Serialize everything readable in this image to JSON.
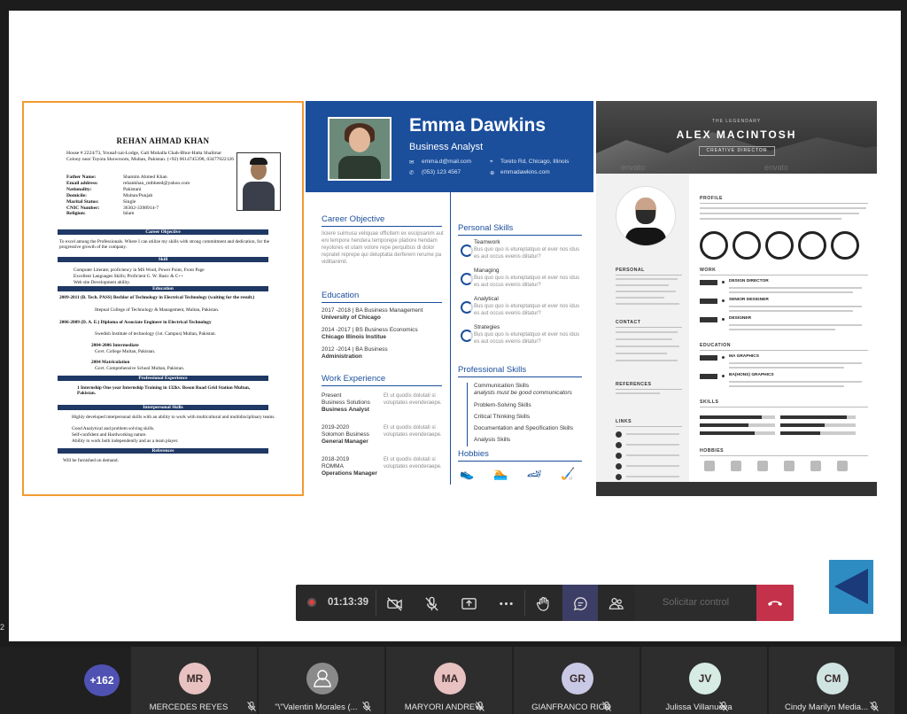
{
  "slide": {
    "edge_number": "2",
    "resume1": {
      "name": "REHAN AHMAD KHAN",
      "address": "House # 2224/73, Yousaf-zai-Lodge, Gali Muhalla Chah-Bhur-Hatta Shalimar Colony near Toyota Showroom, Multan, Pakistan. (+92) 0614745398, 03477022126",
      "fields": [
        {
          "k": "Father Name:",
          "v": "Shamim Ahmed Khan"
        },
        {
          "k": "Email address:",
          "v": "rehankhan_mtbheed@yahoo.com"
        },
        {
          "k": "Nationality:",
          "v": "Pakistani"
        },
        {
          "k": "Domicile:",
          "v": "Multan/Punjab"
        },
        {
          "k": "Marital Status:",
          "v": "Single"
        },
        {
          "k": "CNIC Number:",
          "v": "36302-3398914-7"
        },
        {
          "k": "Religion:",
          "v": "Islam"
        }
      ],
      "career_objective": "Career Objective",
      "objective_text": "To excel among the Professionals. Where I can utilize my skills with strong commitment and dedication, for the progressive growth of the company.",
      "skill": "Skill",
      "skills": [
        "Computer Literate; proficiency in MS Word, Power Point, Front Page",
        "Excellent Languages Skills; Proficient G. W. Basic & C++",
        "Web site Development ability."
      ],
      "education": "Education",
      "edu1": "2009-2011 (B. Tech. PASS) Bechlor of Technology in Electrical Technology (waiting for the result.)",
      "edu1b": "Ittepnal College of Technology & Management, Multan, Pakistan.",
      "edu2": "2006-2009 (D. A. E.) Diploma of Associate Engineer in Electrical Technology",
      "edu2b": "Swedish Institute of technology (1st. Campus) Multan, Pakistan.",
      "edu3": "2004-2006 Intermediate",
      "edu3b": "Govt. College Multan, Pakistan.",
      "edu4": "2004 Matriculation",
      "edu4b": "Govt. Comprehensive School Multan, Pakistan.",
      "professional_experience": "Professional Experience",
      "internship": "1 Internship One year Internship Training in 132kv. Boson Road Grid Station Multan, Pakistan.",
      "interpersonal_skills": "Interpersonal Skills",
      "interpersonal": [
        "Highly developed interpersonal skills with an ability to work with multicultural and multidisciplinary teams.",
        "Good Analytical and problem solving skills.",
        "Self-confident and Hardworking nature.",
        "Ability to work both independently and as a team player."
      ],
      "references": "References",
      "references_text": "Will be furnished on demand."
    },
    "resume2": {
      "name": "Emma Dawkins",
      "title": "Business Analyst",
      "email": "emma.d@mail.com",
      "address": "Toreto Rd, Chicago, Illinois",
      "phone": "(053) 123 4567",
      "website": "emmadawkins.com",
      "career_objective": "Career Objective",
      "objective_text": "Iiciere suimusa veliquae officitem ex escipsanim aut eni tempore hendera temporepe plabore hendam reyolores et utam volore repe perquibus di dolor repratet reprepe qui deluptatia derferem rerume pa viditianimil.",
      "education": "Education",
      "edu": [
        {
          "line": "2017 -2018 | BA Business Management",
          "school": "University of Chicago"
        },
        {
          "line": "2014 -2017 | BS Business Economics",
          "school": "Chicago Illinois Institue"
        },
        {
          "line": "2012 -2014 | BA Business",
          "school": "Administration"
        }
      ],
      "work_experience": "Work Experience",
      "work": [
        {
          "a": "Present",
          "b": "Business Solutions",
          "c": "Business Analyst"
        },
        {
          "a": "2019-2020",
          "b": "Solomon Business",
          "c": "General Manager"
        },
        {
          "a": "2018-2019",
          "b": "ROMMA",
          "c": "Operations Manager"
        }
      ],
      "work_desc": "Et ut quodis dolutati si voluptates evenderaepe.",
      "personal_skills": "Personal Skills",
      "pskills": [
        "Teamwork",
        "Managing",
        "Analytical",
        "Strategies"
      ],
      "pskill_desc": "Bus quo quo is etureptatquo et ever nos idus es aut occus evenis diitatur?",
      "professional_skills": "Professional Skills",
      "prof_skills": [
        "Communication Skills",
        "Problem-Solving Skills",
        "Critical Thinking Skills",
        "Documentation and Specification Skills",
        "Analysis Skills"
      ],
      "prof_note": "analysts must be good communicators",
      "hobbies": "Hobbies"
    },
    "resume3": {
      "legendary": "THE LEGENDARY",
      "name": "ALEX MACINTOSH",
      "title": "CREATIVE DIRECTOR",
      "watermark": "envato",
      "sections": {
        "profile": "PROFILE",
        "work": "WORK",
        "education": "EDUCATION",
        "skills": "SKILLS",
        "hobbies": "HOBBIES",
        "personal": "PERSONAL",
        "contact": "CONTACT",
        "references": "REFERENCES",
        "links": "LINKS"
      },
      "jobs": [
        "DESIGN DIRECTOR",
        "SENIOR DESIGNER",
        "DESIGNER"
      ],
      "schools": [
        "MA GRAPHICS",
        "BA(HONS) GRAPHICS"
      ]
    }
  },
  "toolbar": {
    "timer": "01:13:39",
    "request_control": "Solicitar control"
  },
  "participants": {
    "more_count": "+162",
    "list": [
      {
        "initials": "MR",
        "name": "MERCEDES REYES",
        "color": "#e8c1c1"
      },
      {
        "initials": "",
        "name": "\"\\\"Valentin Morales (...",
        "color": "#8a8a8a"
      },
      {
        "initials": "MA",
        "name": "MARYORI ANDREW",
        "color": "#e8c1c1"
      },
      {
        "initials": "GR",
        "name": "GIANFRANCO RICO",
        "color": "#c9c9e6"
      },
      {
        "initials": "JV",
        "name": "Julissa Villanueva",
        "color": "#d5ebe3"
      },
      {
        "initials": "CM",
        "name": "Cindy Marilyn Media...",
        "color": "#cfe3e0"
      }
    ]
  }
}
